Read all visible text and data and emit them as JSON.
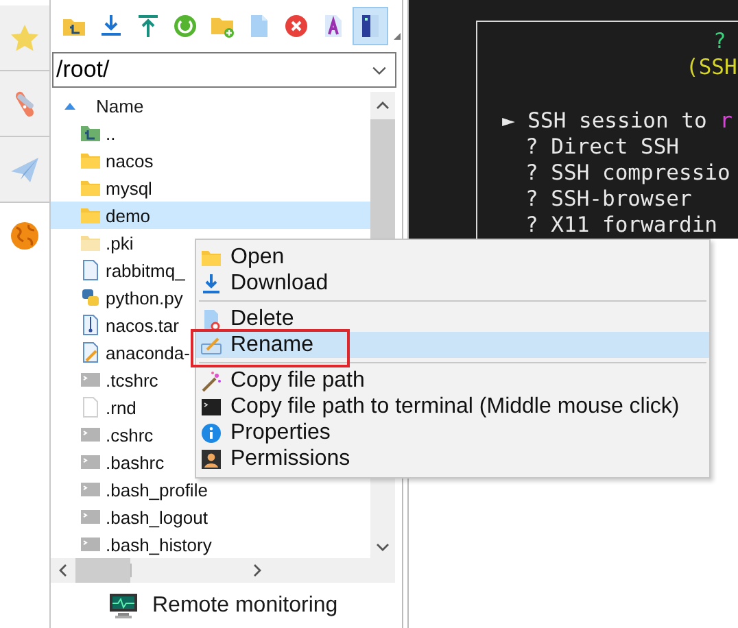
{
  "sidebar": {
    "items": [
      {
        "kind": "star",
        "selected": false
      },
      {
        "kind": "tools",
        "selected": false
      },
      {
        "kind": "plane",
        "selected": false
      },
      {
        "kind": "globe",
        "selected": true
      }
    ]
  },
  "toolbar": {
    "buttons": [
      {
        "kind": "parent-folder",
        "selected": false
      },
      {
        "kind": "download",
        "selected": false
      },
      {
        "kind": "upload",
        "selected": false
      },
      {
        "kind": "refresh",
        "selected": false
      },
      {
        "kind": "new-folder",
        "selected": false
      },
      {
        "kind": "new-file",
        "selected": false
      },
      {
        "kind": "delete",
        "selected": false
      },
      {
        "kind": "text-file",
        "selected": false
      },
      {
        "kind": "split-view",
        "selected": true
      }
    ]
  },
  "path_field": {
    "value": "/root/"
  },
  "file_list": {
    "columns": [
      {
        "label": "Name"
      }
    ],
    "rows": [
      {
        "name": "..",
        "kind": "parent",
        "selected": false
      },
      {
        "name": "nacos",
        "kind": "folder",
        "selected": false
      },
      {
        "name": "mysql",
        "kind": "folder",
        "selected": false
      },
      {
        "name": "demo",
        "kind": "folder",
        "selected": true
      },
      {
        "name": ".pki",
        "kind": "light-folder",
        "selected": false
      },
      {
        "name": "rabbitmq_",
        "kind": "file",
        "selected": false
      },
      {
        "name": "python.py",
        "kind": "python",
        "selected": false
      },
      {
        "name": "nacos.tar",
        "kind": "archive",
        "selected": false
      },
      {
        "name": "anaconda-",
        "kind": "edit",
        "selected": false
      },
      {
        "name": ".tcshrc",
        "kind": "terminal",
        "selected": false
      },
      {
        "name": ".rnd",
        "kind": "blank",
        "selected": false
      },
      {
        "name": ".cshrc",
        "kind": "terminal",
        "selected": false
      },
      {
        "name": ".bashrc",
        "kind": "terminal",
        "selected": false
      },
      {
        "name": ".bash_profile",
        "kind": "terminal",
        "selected": false
      },
      {
        "name": ".bash_logout",
        "kind": "terminal",
        "selected": false
      },
      {
        "name": ".bash_history",
        "kind": "terminal",
        "selected": false
      }
    ]
  },
  "bottom_bar": {
    "label": "Remote monitoring"
  },
  "terminal": {
    "lines": [
      {
        "kind": "title",
        "segments": [
          {
            "text": "?",
            "color": "#3bd07a"
          }
        ]
      },
      {
        "kind": "subtitle",
        "segments": [
          {
            "text": "(SSH",
            "color": "#d6d62a"
          }
        ]
      },
      {
        "kind": "current",
        "segments": [
          {
            "text": "► SSH session to ",
            "color": "#e8e8e8"
          },
          {
            "text": "r",
            "color": "#e040e0"
          }
        ]
      },
      {
        "kind": "option",
        "segments": [
          {
            "text": "? Direct SSH",
            "color": "#e8e8e8"
          }
        ]
      },
      {
        "kind": "option",
        "segments": [
          {
            "text": "? SSH compressio",
            "color": "#e8e8e8"
          }
        ]
      },
      {
        "kind": "option",
        "segments": [
          {
            "text": "? SSH-browser",
            "color": "#e8e8e8"
          }
        ]
      },
      {
        "kind": "option",
        "segments": [
          {
            "text": "? X11 forwardin",
            "color": "#e8e8e8"
          }
        ]
      }
    ]
  },
  "context_menu": {
    "groups": [
      [
        {
          "label": "Open",
          "kind": "folder",
          "selected": false,
          "boxed": false
        },
        {
          "label": "Download",
          "kind": "download",
          "selected": false,
          "boxed": false
        }
      ],
      [
        {
          "label": "Delete",
          "kind": "delete",
          "selected": false,
          "boxed": false
        },
        {
          "label": "Rename",
          "kind": "rename",
          "selected": true,
          "boxed": true
        }
      ],
      [
        {
          "label": "Copy file path",
          "kind": "wand",
          "selected": false,
          "boxed": false
        },
        {
          "label": "Copy file path to terminal (Middle mouse click)",
          "kind": "terminal",
          "selected": false,
          "boxed": false
        },
        {
          "label": "Properties",
          "kind": "info",
          "selected": false,
          "boxed": false
        },
        {
          "label": "Permissions",
          "kind": "user",
          "selected": false,
          "boxed": false
        }
      ]
    ]
  }
}
